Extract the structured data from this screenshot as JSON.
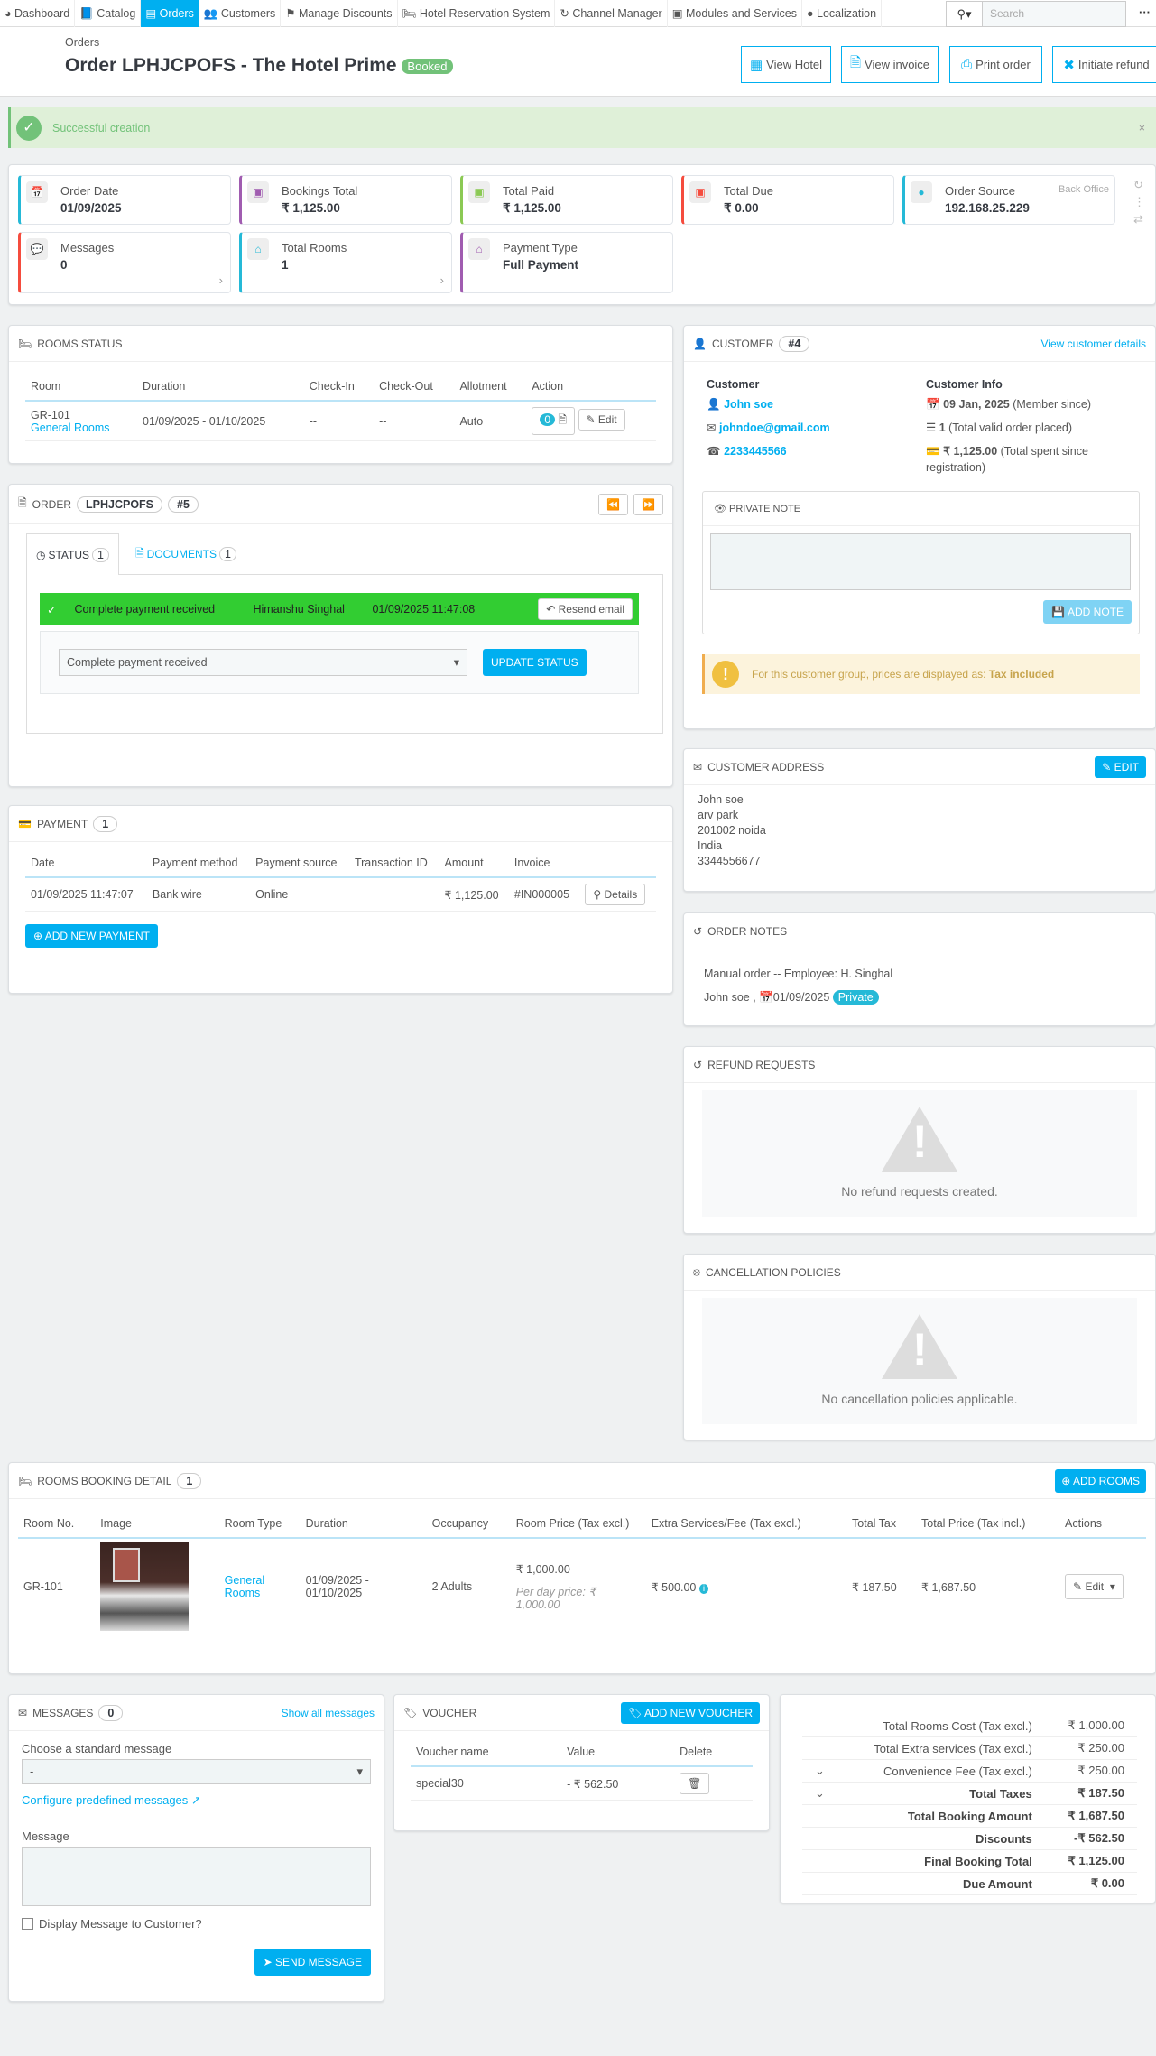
{
  "nav": {
    "items": [
      {
        "label": "Dashboard",
        "icon": "dashboard-icon"
      },
      {
        "label": "Catalog",
        "icon": "book-icon"
      },
      {
        "label": "Orders",
        "icon": "credit-card-icon",
        "active": true
      },
      {
        "label": "Customers",
        "icon": "users-icon"
      },
      {
        "label": "Manage Discounts",
        "icon": "tags-icon"
      },
      {
        "label": "Hotel Reservation System",
        "icon": "bed-icon"
      },
      {
        "label": "Channel Manager",
        "icon": "refresh-icon"
      },
      {
        "label": "Modules and Services",
        "icon": "puzzle-icon"
      },
      {
        "label": "Localization",
        "icon": "globe-icon"
      }
    ],
    "search_placeholder": "Search",
    "accent": "#00aff0"
  },
  "header": {
    "breadcrumb": "Orders",
    "title": "Order LPHJCPOFS - The Hotel Prime",
    "status_badge": "Booked",
    "buttons": [
      "View Hotel",
      "View invoice",
      "Print order",
      "Initiate refund"
    ]
  },
  "alert": {
    "text": "Successful creation"
  },
  "kpis": [
    {
      "label": "Order Date",
      "value": "01/09/2025",
      "color": "#25b9d7"
    },
    {
      "label": "Bookings Total",
      "value": "₹ 1,125.00",
      "color": "#a05cb0"
    },
    {
      "label": "Total Paid",
      "value": "₹ 1,125.00",
      "color": "#8bc954"
    },
    {
      "label": "Total Due",
      "value": "₹ 0.00",
      "color": "#f54c3e"
    },
    {
      "label": "Order Source",
      "value": "192.168.25.229",
      "extra": "Back Office",
      "color": "#25b9d7"
    },
    {
      "label": "Messages",
      "value": "0",
      "color": "#f54c3e"
    },
    {
      "label": "Total Rooms",
      "value": "1",
      "color": "#25b9d7"
    },
    {
      "label": "Payment Type",
      "value": "Full Payment",
      "color": "#a05cb0"
    }
  ],
  "rooms_status": {
    "title": "Rooms Status",
    "headers": [
      "Room",
      "Duration",
      "Check-In",
      "Check-Out",
      "Allotment",
      "Action"
    ],
    "row": {
      "room": "GR-101",
      "room_type": "General Rooms",
      "duration": "01/09/2025 - 01/10/2025",
      "check_in": "--",
      "check_out": "--",
      "allotment": "Auto",
      "doc_count": "0",
      "edit": "Edit"
    }
  },
  "order": {
    "title": "Order",
    "reference": "LPHJCPOFS",
    "id": "#5",
    "tabs": [
      {
        "label": "Status",
        "count": "1"
      },
      {
        "label": "Documents",
        "count": "1"
      }
    ],
    "history": {
      "status": "Complete payment received",
      "employee": "Himanshu Singhal",
      "date": "01/09/2025 11:47:08",
      "resend": "Resend email"
    },
    "select_value": "Complete payment received",
    "update_button": "Update Status"
  },
  "payment": {
    "title": "Payment",
    "count": "1",
    "headers": [
      "Date",
      "Payment method",
      "Payment source",
      "Transaction ID",
      "Amount",
      "Invoice"
    ],
    "row": {
      "date": "01/09/2025 11:47:07",
      "method": "Bank wire",
      "source": "Online",
      "transaction_id": "",
      "amount": "₹ 1,125.00",
      "invoice": "#IN000005",
      "details": "Details"
    },
    "add_button": "Add New Payment"
  },
  "customer": {
    "title": "Customer",
    "id": "#4",
    "view_details": "View customer details",
    "label_customer": "Customer",
    "name": "John soe",
    "email": "johndoe@gmail.com",
    "phone": "2233445566",
    "label_info": "Customer Info",
    "member_since": "09 Jan, 2025",
    "member_since_suffix": "(Member since)",
    "orders": "1",
    "orders_suffix": "(Total valid order placed)",
    "spent": "₹ 1,125.00",
    "spent_suffix": "(Total spent since registration)",
    "private_note_title": "Private Note",
    "add_note": "Add Note",
    "tax_notice": "For this customer group, prices are displayed as:",
    "tax_mode": "Tax included"
  },
  "address": {
    "title": "Customer Address",
    "edit": "Edit",
    "lines": [
      "John soe",
      "arv park",
      "201002 noida",
      "India",
      "3344556677"
    ]
  },
  "order_notes": {
    "title": "Order Notes",
    "note": "Manual order -- Employee: H. Singhal",
    "author": "John soe ,",
    "date": "01/09/2025",
    "badge": "Private"
  },
  "refunds": {
    "title": "Refund Requests",
    "empty": "No refund requests created."
  },
  "cancellation": {
    "title": "Cancellation Policies",
    "empty": "No cancellation policies applicable."
  },
  "booking_detail": {
    "title": "Rooms Booking Detail",
    "count": "1",
    "add_button": "Add Rooms",
    "headers": [
      "Room No.",
      "Image",
      "Room Type",
      "Duration",
      "Occupancy",
      "Room Price (Tax excl.)",
      "Extra Services/Fee (Tax excl.)",
      "Total Tax",
      "Total Price (Tax incl.)",
      "Actions"
    ],
    "row": {
      "room_no": "GR-101",
      "room_type": "General Rooms",
      "duration": "01/09/2025 - 01/10/2025",
      "occupancy": "2 Adults",
      "price": "₹ 1,000.00",
      "per_day": "Per day price: ₹ 1,000.00",
      "extra": "₹ 500.00",
      "tax": "₹ 187.50",
      "total": "₹ 1,687.50",
      "edit": "Edit"
    }
  },
  "messages": {
    "title": "Messages",
    "count": "0",
    "show_all": "Show all messages",
    "choose_label": "Choose a standard message",
    "select_value": "-",
    "configure": "Configure predefined messages",
    "message_label": "Message",
    "display_checkbox": "Display Message to Customer?",
    "send": "Send Message"
  },
  "voucher": {
    "title": "Voucher",
    "add": "Add New Voucher",
    "headers": [
      "Voucher name",
      "Value",
      "Delete"
    ],
    "row": {
      "name": "special30",
      "value": "- ₹ 562.50"
    }
  },
  "totals": [
    {
      "label": "Total Rooms Cost (Tax excl.)",
      "value": "₹ 1,000.00"
    },
    {
      "label": "Total Extra services (Tax excl.)",
      "value": "₹ 250.00"
    },
    {
      "label": "Convenience Fee (Tax excl.)",
      "value": "₹ 250.00",
      "chevron": true
    },
    {
      "label": "Total Taxes",
      "value": "₹ 187.50",
      "bold": true,
      "chevron": true
    },
    {
      "label": "Total Booking Amount",
      "value": "₹ 1,687.50",
      "bold": true
    },
    {
      "label": "Discounts",
      "value": "-₹ 562.50",
      "bold": true
    },
    {
      "label": "Final Booking Total",
      "value": "₹ 1,125.00",
      "bold": true
    },
    {
      "label": "Due Amount",
      "value": "₹ 0.00",
      "bold": true
    }
  ]
}
